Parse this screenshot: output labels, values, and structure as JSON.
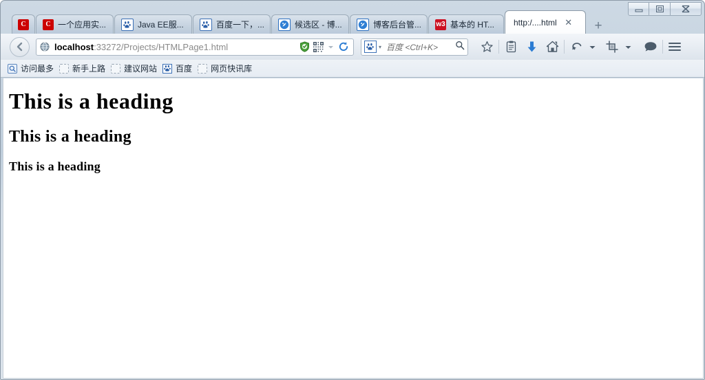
{
  "window": {
    "controls": [
      {
        "name": "minimize",
        "glyph": "minimize-icon"
      },
      {
        "name": "restore",
        "glyph": "restore-icon"
      },
      {
        "name": "close",
        "glyph": "close-icon"
      }
    ]
  },
  "tabs": [
    {
      "label": "",
      "icon": "chrome-c-icon",
      "icon_text": "C",
      "active": false
    },
    {
      "label": "一个应用实...",
      "icon": "chrome-c-icon",
      "icon_text": "C",
      "active": false
    },
    {
      "label": "Java EE服...",
      "icon": "baidu-icon",
      "icon_text": "",
      "active": false
    },
    {
      "label": "百度一下，...",
      "icon": "baidu-icon",
      "icon_text": "",
      "active": false
    },
    {
      "label": "候选区 - 博...",
      "icon": "blog-icon",
      "icon_text": "",
      "active": false
    },
    {
      "label": "博客后台管...",
      "icon": "blog-icon",
      "icon_text": "",
      "active": false
    },
    {
      "label": "基本的 HT...",
      "icon": "w3school-icon",
      "icon_text": "w3",
      "active": false
    },
    {
      "label": "http:/....html",
      "icon": "",
      "icon_text": "",
      "active": true,
      "close_glyph": "✕"
    }
  ],
  "newtab": {
    "label": "+",
    "name": "new-tab-button"
  },
  "navbar": {
    "back_button": "back-arrow-icon",
    "url": {
      "host": "localhost",
      "path": ":33272/Projects/HTMLPage1.html",
      "identity_icon": "globe-icon",
      "shield_icon": "shield-check-icon",
      "qr_icon": "qr-code-icon",
      "caret_icon": "chevron-down-icon",
      "reload_icon": "reload-icon"
    },
    "search": {
      "engine_icon": "baidu-icon",
      "placeholder": "百度 <Ctrl+K>",
      "magnifier_icon": "search-icon"
    },
    "buttons": [
      {
        "name": "bookmark-star-button",
        "icon": "star-icon"
      },
      {
        "name": "reading-list-button",
        "icon": "clipboard-icon"
      },
      {
        "name": "downloads-button",
        "icon": "download-arrow-icon"
      },
      {
        "name": "home-button",
        "icon": "home-icon"
      },
      {
        "name": "history-back-button",
        "icon": "undo-arrow-icon"
      },
      {
        "name": "history-dropdown-button",
        "icon": "chevron-down-icon"
      },
      {
        "name": "screenshot-crop-button",
        "icon": "crop-icon"
      },
      {
        "name": "screenshot-dropdown-button",
        "icon": "chevron-down-icon"
      },
      {
        "name": "feedback-button",
        "icon": "speech-bubble-icon"
      },
      {
        "name": "menu-button",
        "icon": "hamburger-menu-icon"
      }
    ]
  },
  "bookmarks": [
    {
      "label": "访问最多",
      "icon": "most-visited-icon"
    },
    {
      "label": "新手上路",
      "icon": "placeholder-icon"
    },
    {
      "label": "建议网站",
      "icon": "placeholder-icon"
    },
    {
      "label": "百度",
      "icon": "baidu-icon"
    },
    {
      "label": "网页快讯库",
      "icon": "placeholder-icon"
    }
  ],
  "page": {
    "heading1": "This is a heading",
    "heading2": "This is a heading",
    "heading3": "This is a heading"
  },
  "colors": {
    "chrome_frame": "#c6d3e0",
    "accent_blue": "#2b7cd3",
    "shield_green": "#4aa03a",
    "tab_active_bg": "#ffffff",
    "favicon_red": "#cc0000"
  }
}
